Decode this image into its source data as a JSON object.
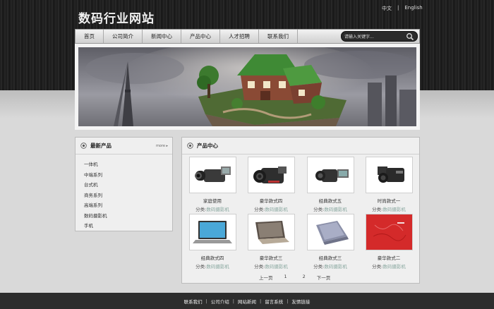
{
  "site": {
    "title": "数码行业网站"
  },
  "lang": {
    "zh": "中文",
    "sep": "|",
    "en": "English"
  },
  "nav": {
    "items": [
      "首页",
      "公司简介",
      "新闻中心",
      "产品中心",
      "人才招聘",
      "联系我们"
    ],
    "search_placeholder": "请输入关键字..."
  },
  "sidebar": {
    "title": "最新产品",
    "more": "more ▸",
    "items": [
      "一体机",
      "中端系列",
      "台式机",
      "商务系列",
      "高端系列",
      "数码摄影机",
      "手机"
    ]
  },
  "products": {
    "title": "产品中心",
    "category_prefix": "分类:",
    "category_name": "数码摄影机",
    "items": [
      {
        "name": "家庭使用"
      },
      {
        "name": "豪华款式四"
      },
      {
        "name": "经典款式五"
      },
      {
        "name": "时尚款式一"
      },
      {
        "name": "经典款式四"
      },
      {
        "name": "豪华款式三"
      },
      {
        "name": "经典款式三"
      },
      {
        "name": "豪华款式二"
      }
    ]
  },
  "pager": {
    "prev": "上一页",
    "p1": "1",
    "p2": "2",
    "next": "下一页"
  },
  "footer": {
    "links": [
      "联系我们",
      "公司介绍",
      "网站新闻",
      "留言系统",
      "友情链接"
    ],
    "sep": "|"
  },
  "colors": {
    "category_link": "#8aa8a0",
    "footer_bg": "#2d2d2d",
    "search_bg": "#2a2a2a"
  }
}
